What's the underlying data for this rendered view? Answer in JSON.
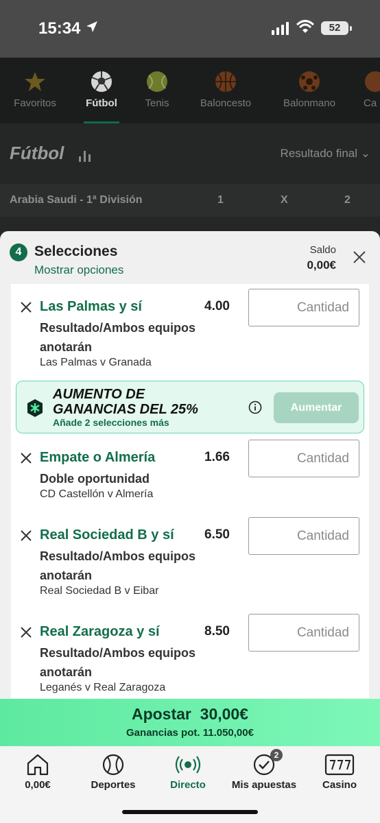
{
  "status_bar": {
    "time": "15:34",
    "battery": "52"
  },
  "sports_nav": [
    {
      "label": "Favoritos",
      "icon": "star-icon"
    },
    {
      "label": "Fútbol",
      "icon": "soccer-ball-icon",
      "active": true
    },
    {
      "label": "Tenis",
      "icon": "tennis-ball-icon"
    },
    {
      "label": "Baloncesto",
      "icon": "basketball-icon"
    },
    {
      "label": "Balonmano",
      "icon": "handball-icon"
    },
    {
      "label": "Ca",
      "icon": "more-sport-icon"
    }
  ],
  "page": {
    "title": "Fútbol",
    "market_selector": "Resultado final",
    "league_row": {
      "name": "Arabia Saudi - 1ª División",
      "col1": "1",
      "colx": "X",
      "col2": "2"
    }
  },
  "betslip": {
    "count": "4",
    "title": "Selecciones",
    "options_link": "Mostrar opciones",
    "balance_label": "Saldo",
    "balance_value": "0,00€",
    "stake_placeholder": "Cantidad",
    "bets": [
      {
        "selection": "Las Palmas y sí",
        "odds": "4.00",
        "market": "Resultado/Ambos equipos anotarán",
        "match": "Las Palmas v Granada"
      },
      {
        "selection": "Empate o Almería",
        "odds": "1.66",
        "market": "Doble oportunidad",
        "match": "CD Castellón v Almería"
      },
      {
        "selection": "Real Sociedad B y sí",
        "odds": "6.50",
        "market": "Resultado/Ambos equipos anotarán",
        "match": "Real Sociedad B v Eibar"
      },
      {
        "selection": "Real Zaragoza y sí",
        "odds": "8.50",
        "market": "Resultado/Ambos equipos anotarán",
        "match": "Leganés v Real Zaragoza"
      }
    ],
    "boost": {
      "title_line1": "AUMENTO DE",
      "title_line2": "GANANCIAS DEL 25%",
      "subtitle": "Añade 2 selecciones más",
      "button": "Aumentar"
    },
    "place_bet": {
      "label": "Apostar",
      "amount": "30,00€",
      "potential": "Ganancias pot. 11.050,00€"
    }
  },
  "tabbar": [
    {
      "label": "0,00€",
      "icon": "home-icon"
    },
    {
      "label": "Deportes",
      "icon": "sports-ball-icon"
    },
    {
      "label": "Directo",
      "icon": "live-broadcast-icon",
      "active": true
    },
    {
      "label": "Mis apuestas",
      "icon": "check-circle-icon",
      "badge": "2"
    },
    {
      "label": "Casino",
      "icon": "slot-machine-icon"
    }
  ],
  "colors": {
    "brand_green": "#126e4a",
    "cta_green": "#6af0ad",
    "boost_bg": "#e3f8ef"
  }
}
